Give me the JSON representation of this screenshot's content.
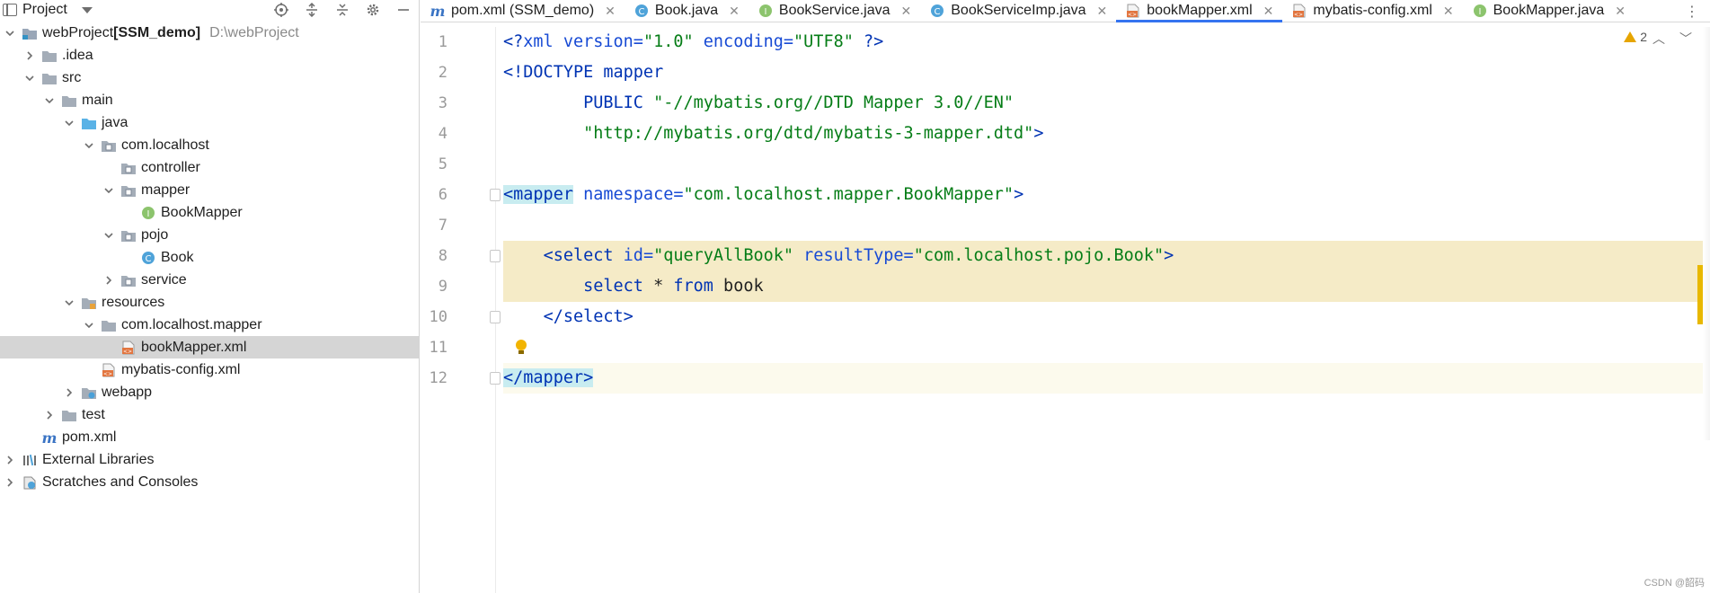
{
  "project_panel": {
    "title": "Project",
    "tree": [
      {
        "label": "webProject",
        "suffix": "[SSM_demo]",
        "path": "D:\\webProject",
        "depth": 0,
        "expanded": true,
        "icon": "module-folder-icon"
      },
      {
        "label": ".idea",
        "depth": 1,
        "expanded": false,
        "icon": "folder-icon"
      },
      {
        "label": "src",
        "depth": 1,
        "expanded": true,
        "icon": "folder-icon"
      },
      {
        "label": "main",
        "depth": 2,
        "expanded": true,
        "icon": "folder-icon"
      },
      {
        "label": "java",
        "depth": 3,
        "expanded": true,
        "icon": "source-folder-icon"
      },
      {
        "label": "com.localhost",
        "depth": 4,
        "expanded": true,
        "icon": "package-icon"
      },
      {
        "label": "controller",
        "depth": 5,
        "expanded": null,
        "icon": "package-icon"
      },
      {
        "label": "mapper",
        "depth": 5,
        "expanded": true,
        "icon": "package-icon"
      },
      {
        "label": "BookMapper",
        "depth": 6,
        "expanded": null,
        "icon": "interface-icon"
      },
      {
        "label": "pojo",
        "depth": 5,
        "expanded": true,
        "icon": "package-icon"
      },
      {
        "label": "Book",
        "depth": 6,
        "expanded": null,
        "icon": "class-icon"
      },
      {
        "label": "service",
        "depth": 5,
        "expanded": false,
        "icon": "package-icon"
      },
      {
        "label": "resources",
        "depth": 3,
        "expanded": true,
        "icon": "resources-folder-icon"
      },
      {
        "label": "com.localhost.mapper",
        "depth": 4,
        "expanded": true,
        "icon": "folder-icon"
      },
      {
        "label": "bookMapper.xml",
        "depth": 5,
        "expanded": null,
        "icon": "xml-file-icon",
        "selected": true
      },
      {
        "label": "mybatis-config.xml",
        "depth": 4,
        "expanded": null,
        "icon": "xml-file-icon"
      },
      {
        "label": "webapp",
        "depth": 3,
        "expanded": false,
        "icon": "web-folder-icon"
      },
      {
        "label": "test",
        "depth": 2,
        "expanded": false,
        "icon": "folder-icon"
      },
      {
        "label": "pom.xml",
        "depth": 1,
        "expanded": null,
        "icon": "maven-file-icon"
      },
      {
        "label": "External Libraries",
        "depth": 0,
        "expanded": false,
        "icon": "libraries-icon"
      },
      {
        "label": "Scratches and Consoles",
        "depth": 0,
        "expanded": false,
        "icon": "scratches-icon"
      }
    ]
  },
  "editor": {
    "tabs": [
      {
        "label": "pom.xml (SSM_demo)",
        "icon": "maven-file-icon",
        "active": false
      },
      {
        "label": "Book.java",
        "icon": "class-icon",
        "active": false
      },
      {
        "label": "BookService.java",
        "icon": "interface-icon",
        "active": false
      },
      {
        "label": "BookServiceImp.java",
        "icon": "class-icon",
        "active": false
      },
      {
        "label": "bookMapper.xml",
        "icon": "xml-file-icon",
        "active": true
      },
      {
        "label": "mybatis-config.xml",
        "icon": "xml-file-icon",
        "active": false
      },
      {
        "label": "BookMapper.java",
        "icon": "interface-icon",
        "active": false
      }
    ],
    "warning_count": "2",
    "code_lines": [
      {
        "n": "1",
        "tokens": [
          [
            "tag",
            "<?"
          ],
          [
            "attr",
            "xml version="
          ],
          [
            "str",
            "\"1.0\""
          ],
          [
            "plain",
            " "
          ],
          [
            "attr",
            "encoding="
          ],
          [
            "str",
            "\"UTF8\""
          ],
          [
            "plain",
            " "
          ],
          [
            "tag",
            "?>"
          ]
        ]
      },
      {
        "n": "2",
        "tokens": [
          [
            "tag",
            "<!DOCTYPE mapper"
          ]
        ]
      },
      {
        "n": "3",
        "tokens": [
          [
            "plain",
            "        "
          ],
          [
            "tag",
            "PUBLIC "
          ],
          [
            "str",
            "\"-//mybatis.org//DTD Mapper 3.0//EN\""
          ]
        ]
      },
      {
        "n": "4",
        "tokens": [
          [
            "plain",
            "        "
          ],
          [
            "str",
            "\"http://mybatis.org/dtd/mybatis-3-mapper.dtd\""
          ],
          [
            "tag",
            ">"
          ]
        ]
      },
      {
        "n": "5",
        "tokens": []
      },
      {
        "n": "6",
        "tokens": [
          [
            "taghl",
            "<mapper"
          ],
          [
            "plain",
            " "
          ],
          [
            "attr",
            "namespace="
          ],
          [
            "str",
            "\"com.localhost.mapper.BookMapper\""
          ],
          [
            "tag",
            ">"
          ]
        ]
      },
      {
        "n": "7",
        "tokens": []
      },
      {
        "n": "8",
        "tokens": [
          [
            "plain",
            "    "
          ],
          [
            "tag",
            "<select "
          ],
          [
            "attr",
            "id="
          ],
          [
            "str",
            "\"queryAllBook\""
          ],
          [
            "plain",
            " "
          ],
          [
            "attr",
            "resultType="
          ],
          [
            "str",
            "\"com.localhost.pojo.Book\""
          ],
          [
            "tag",
            ">"
          ]
        ]
      },
      {
        "n": "9",
        "tokens": [
          [
            "plain",
            "        "
          ],
          [
            "kw",
            "select"
          ],
          [
            "plain",
            " * "
          ],
          [
            "kw",
            "from"
          ],
          [
            "plain",
            " book"
          ]
        ]
      },
      {
        "n": "10",
        "tokens": [
          [
            "plain",
            "    "
          ],
          [
            "tag",
            "</select>"
          ]
        ]
      },
      {
        "n": "11",
        "tokens": []
      },
      {
        "n": "12",
        "tokens": [
          [
            "taghl",
            "</mapper>"
          ]
        ]
      }
    ]
  },
  "watermark": "CSDN @韶码",
  "colors": {
    "accent": "#3574f0",
    "xml_tag": "#0033b3",
    "string": "#067d17",
    "highlight": "#f5ebc7"
  }
}
